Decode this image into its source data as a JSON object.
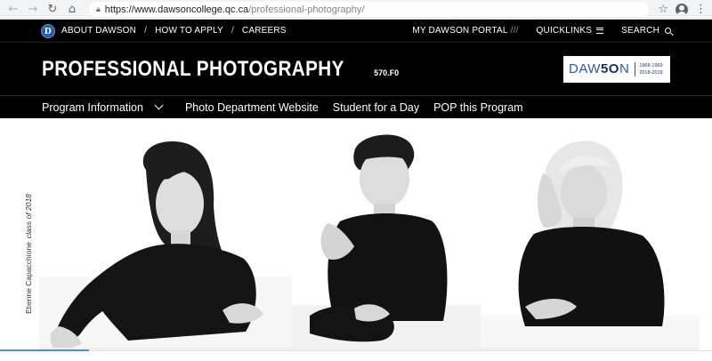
{
  "browser": {
    "url_host": "https://www.dawsoncollege.qc.ca",
    "url_path": "/professional-photography/"
  },
  "topbar": {
    "logo_letter": "D",
    "links": [
      "ABOUT DAWSON",
      "HOW TO APPLY",
      "CAREERS"
    ],
    "separator": "/",
    "portal": "MY DAWSON PORTAL",
    "portal_suffix": "///",
    "quicklinks": "QUICKLINKS",
    "search": "SEARCH"
  },
  "program": {
    "title": "PROFESSIONAL PHOTOGRAPHY",
    "code": "570.F0"
  },
  "anniversary": {
    "word_prefix": "DAW",
    "word_bold": "5O",
    "word_suffix": "N",
    "years_1": "1968-1969",
    "years_2": "2018-2019"
  },
  "mainnav": {
    "items": [
      "Program Information",
      "Photo Department Website",
      "Student for a Day",
      "POP this Program"
    ]
  },
  "hero": {
    "credit_name": "Etienne Capacchione",
    "credit_class": "class of 2018"
  },
  "colors": {
    "brand_blue": "#2b5aa6",
    "navy": "#16305f",
    "header_bg": "#000000"
  }
}
